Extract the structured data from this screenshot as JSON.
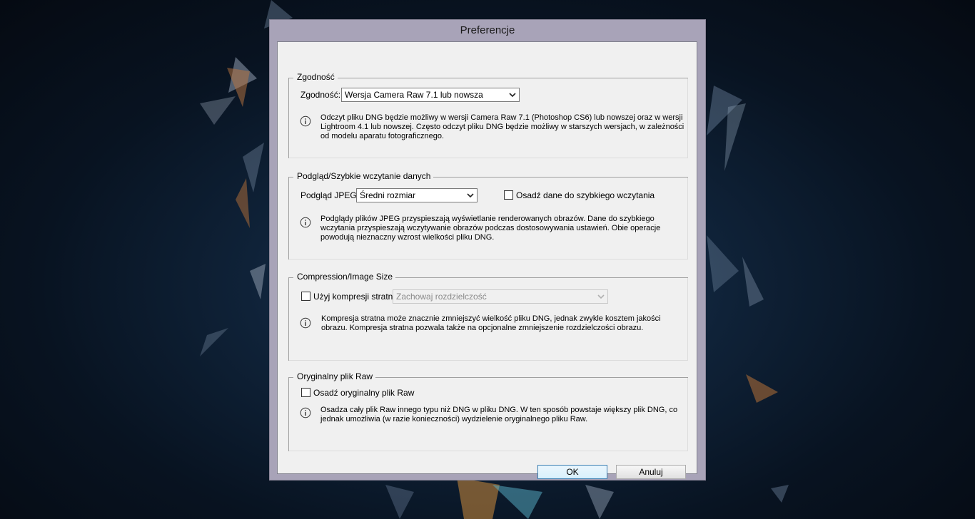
{
  "window": {
    "title": "Preferencje"
  },
  "compat": {
    "legend": "Zgodność",
    "label": "Zgodność:",
    "value": "Wersja Camera Raw 7.1 lub nowsza",
    "info": "Odczyt pliku DNG będzie możliwy w wersji Camera Raw 7.1 (Photoshop CS6) lub nowszej oraz w wersji Lightroom 4.1 lub nowszej. Często odczyt pliku DNG będzie możliwy w starszych wersjach, w zależności od modelu aparatu fotograficznego."
  },
  "preview": {
    "legend": "Podgląd/Szybkie wczytanie danych",
    "label": "Podgląd JPEG:",
    "value": "Średni rozmiar",
    "checkbox_label": "Osadź dane do szybkiego wczytania",
    "checkbox_checked": false,
    "info": "Podglądy plików JPEG przyspieszają wyświetlanie renderowanych obrazów. Dane do szybkiego wczytania przyspieszają wczytywanie obrazów podczas dostosowywania ustawień. Obie operacje powodują nieznaczny wzrost wielkości pliku DNG."
  },
  "compression": {
    "legend": "Compression/Image Size",
    "checkbox_label": "Użyj kompresji stratnej:",
    "checkbox_checked": false,
    "value": "Zachowaj rozdzielczość",
    "info": "Kompresja stratna może znacznie zmniejszyć wielkość pliku DNG, jednak zwykle kosztem jakości obrazu. Kompresja stratna pozwala także na opcjonalne zmniejszenie rozdzielczości obrazu."
  },
  "raw": {
    "legend": "Oryginalny plik Raw",
    "checkbox_label": "Osadź oryginalny plik Raw",
    "checkbox_checked": false,
    "info": "Osadza cały plik Raw innego typu niż DNG w pliku DNG.  W ten sposób powstaje większy plik DNG, co jednak umożliwia (w razie konieczności) wydzielenie oryginalnego pliku Raw."
  },
  "buttons": {
    "ok": "OK",
    "cancel": "Anuluj"
  },
  "colors": {
    "window_frame": "#a8a3b8",
    "client_bg": "#f0f0f0",
    "default_button_border": "#3c7fb1"
  },
  "icons": {
    "info": "info-circle-icon",
    "dropdown": "chevron-down-icon"
  }
}
